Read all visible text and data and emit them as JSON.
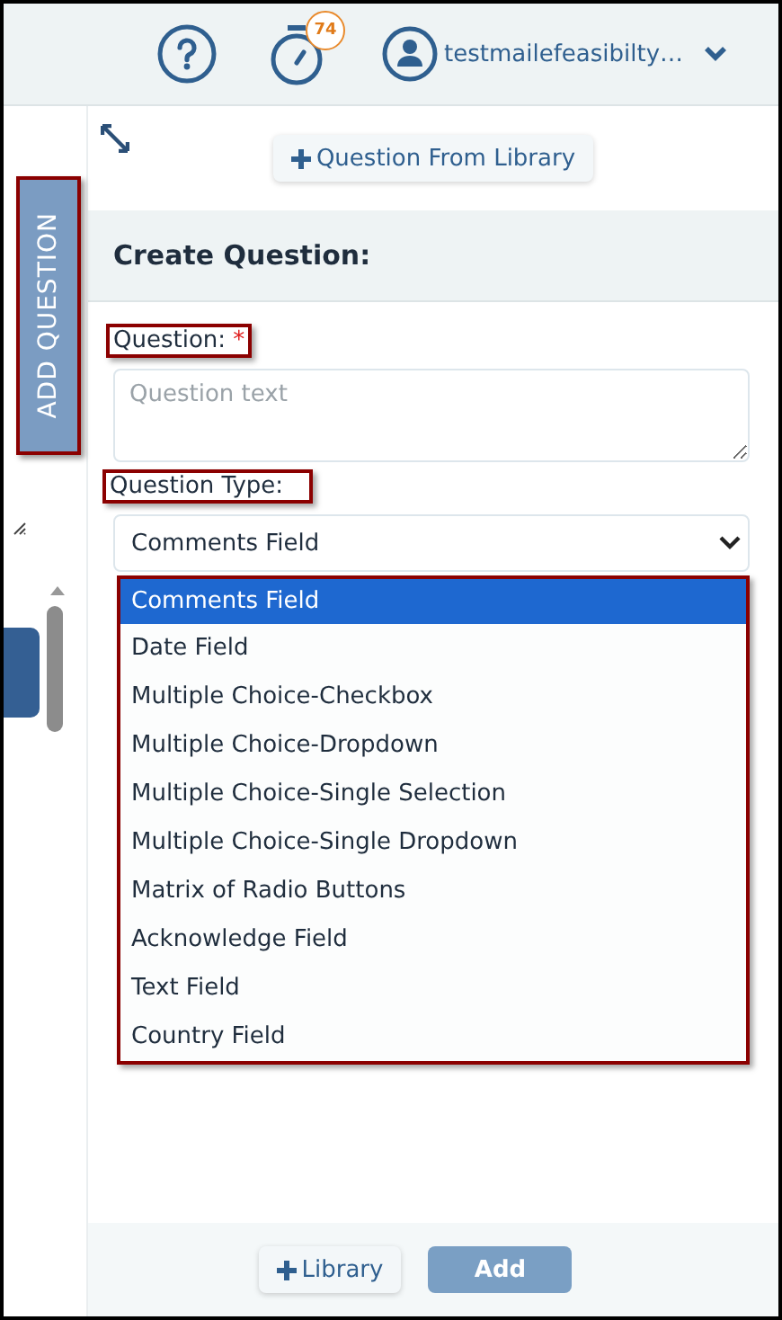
{
  "header": {
    "timer_badge": "74",
    "user_name": "testmailefeasibilty…"
  },
  "side_tab": {
    "label": "ADD QUESTION"
  },
  "library_button": {
    "label": "Question From Library"
  },
  "section_title": "Create Question:",
  "question": {
    "label": "Question:",
    "required_mark": "*",
    "placeholder": "Question text"
  },
  "question_type": {
    "label": "Question Type:",
    "value": "Comments Field",
    "options": [
      {
        "label": "Comments Field",
        "selected": true
      },
      {
        "label": "Date Field",
        "selected": false
      },
      {
        "label": "Multiple Choice-Checkbox",
        "selected": false
      },
      {
        "label": "Multiple Choice-Dropdown",
        "selected": false
      },
      {
        "label": "Multiple Choice-Single Selection",
        "selected": false
      },
      {
        "label": "Multiple Choice-Single Dropdown",
        "selected": false
      },
      {
        "label": "Matrix of Radio Buttons",
        "selected": false
      },
      {
        "label": "Acknowledge Field",
        "selected": false
      },
      {
        "label": "Text Field",
        "selected": false
      },
      {
        "label": "Country Field",
        "selected": false
      }
    ]
  },
  "footer": {
    "buttons": [
      {
        "kind": "library",
        "label": "Library"
      },
      {
        "kind": "primary",
        "label": "Add"
      }
    ]
  }
}
